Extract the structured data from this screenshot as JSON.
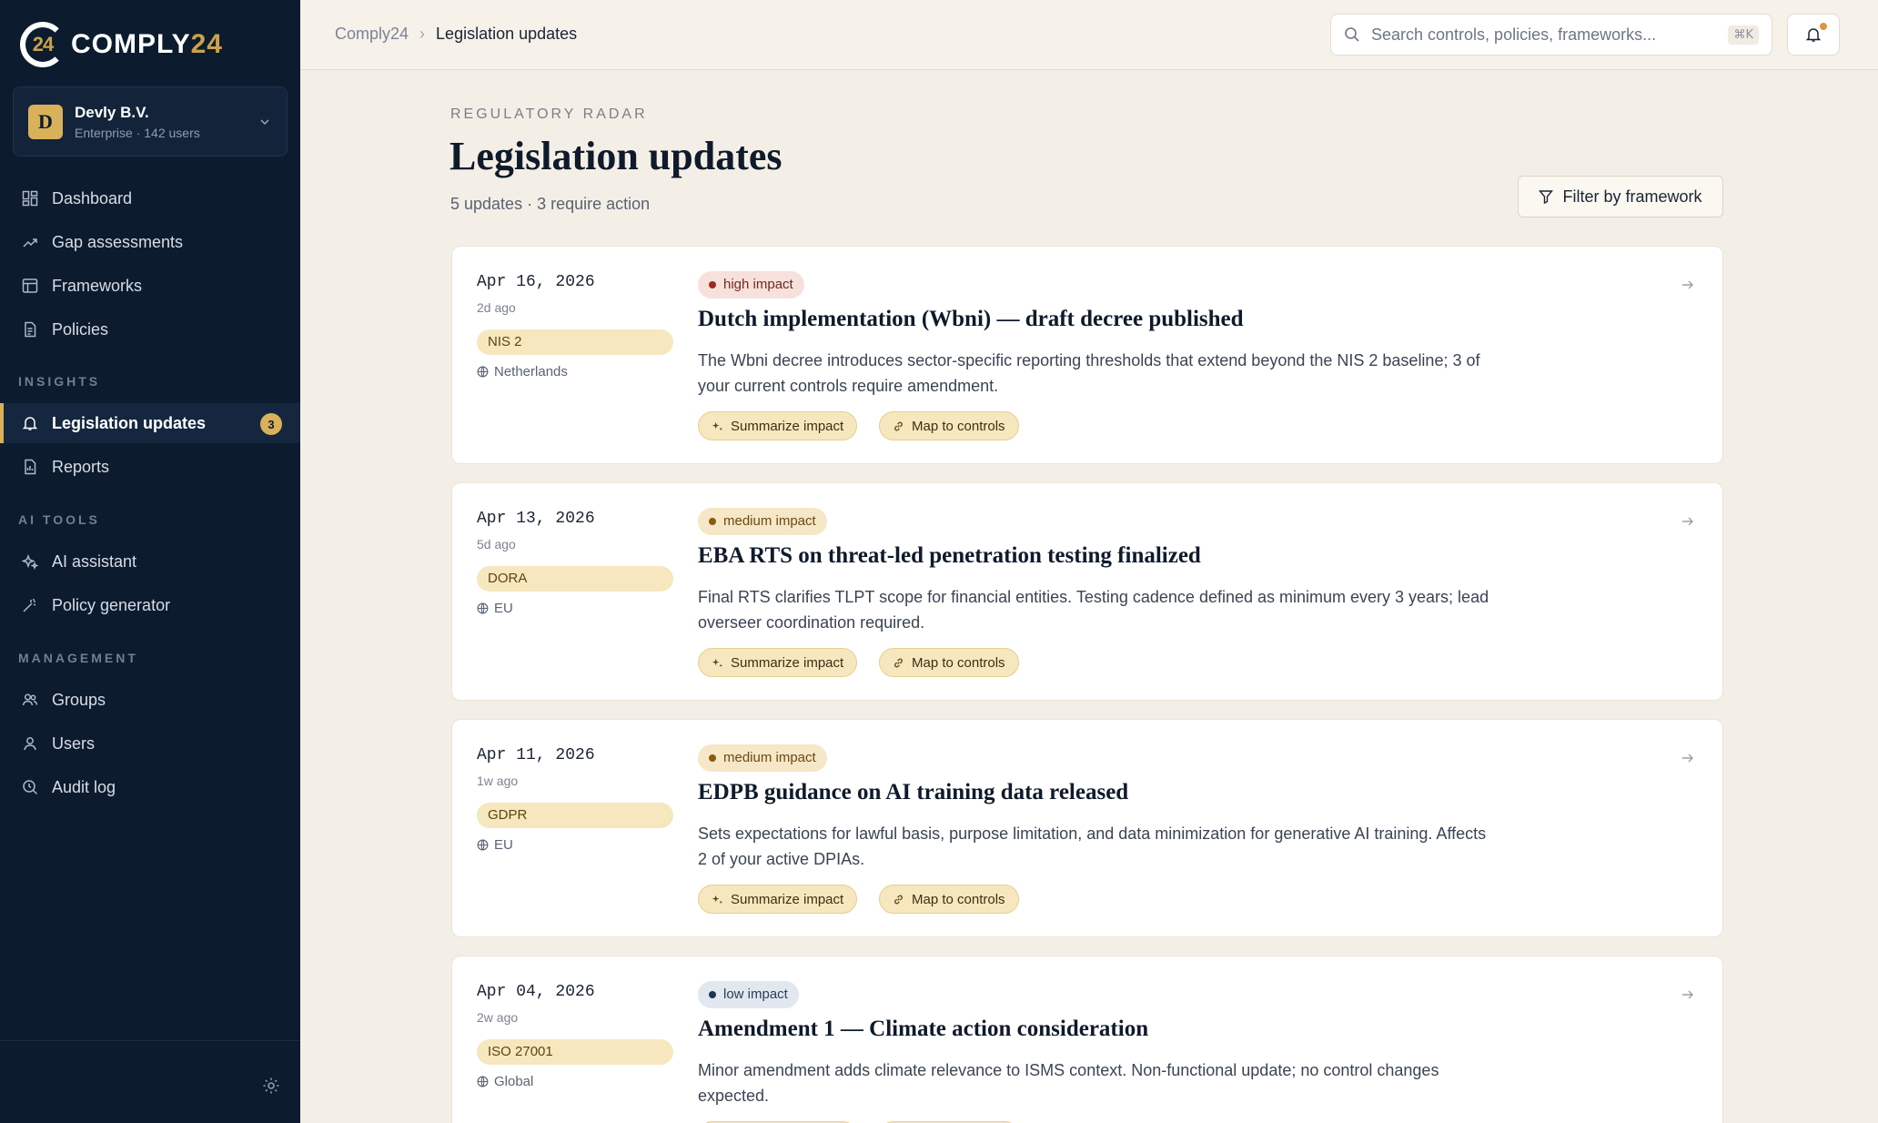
{
  "brand": {
    "mark": "24",
    "name_main": "COMPLY",
    "name_num": "24"
  },
  "org": {
    "initial": "D",
    "name": "Devly B.V.",
    "meta": "Enterprise · 142 users"
  },
  "nav": {
    "main": [
      {
        "label": "Dashboard",
        "icon": "dashboard-icon"
      },
      {
        "label": "Gap assessments",
        "icon": "trend-icon"
      },
      {
        "label": "Frameworks",
        "icon": "table-icon"
      },
      {
        "label": "Policies",
        "icon": "document-icon"
      }
    ],
    "insights_heading": "INSIGHTS",
    "insights": [
      {
        "label": "Legislation updates",
        "icon": "bell-icon",
        "badge": "3",
        "active": true
      },
      {
        "label": "Reports",
        "icon": "report-icon"
      }
    ],
    "ai_heading": "AI TOOLS",
    "ai": [
      {
        "label": "AI assistant",
        "icon": "sparkle-icon"
      },
      {
        "label": "Policy generator",
        "icon": "wand-icon"
      }
    ],
    "management_heading": "MANAGEMENT",
    "management": [
      {
        "label": "Groups",
        "icon": "users-icon"
      },
      {
        "label": "Users",
        "icon": "user-icon"
      },
      {
        "label": "Audit log",
        "icon": "search-log-icon"
      }
    ]
  },
  "breadcrumb": {
    "root": "Comply24",
    "current": "Legislation updates"
  },
  "search": {
    "placeholder": "Search controls, policies, frameworks...",
    "shortcut": "⌘K"
  },
  "page": {
    "eyebrow": "REGULATORY RADAR",
    "title": "Legislation updates",
    "subtitle": "5 updates · 3 require action",
    "filter_label": "Filter by framework"
  },
  "actions": {
    "summarize": "Summarize impact",
    "map": "Map to controls"
  },
  "updates": [
    {
      "date": "Apr 16, 2026",
      "ago": "2d ago",
      "framework": "NIS 2",
      "region": "Netherlands",
      "impact": "high impact",
      "impact_level": "high",
      "title": "Dutch implementation (Wbni) — draft decree published",
      "description": "The Wbni decree introduces sector-specific reporting thresholds that extend beyond the NIS 2 baseline; 3 of your current controls require amendment."
    },
    {
      "date": "Apr 13, 2026",
      "ago": "5d ago",
      "framework": "DORA",
      "region": "EU",
      "impact": "medium impact",
      "impact_level": "medium",
      "title": "EBA RTS on threat-led penetration testing finalized",
      "description": "Final RTS clarifies TLPT scope for financial entities. Testing cadence defined as minimum every 3 years; lead overseer coordination required."
    },
    {
      "date": "Apr 11, 2026",
      "ago": "1w ago",
      "framework": "GDPR",
      "region": "EU",
      "impact": "medium impact",
      "impact_level": "medium",
      "title": "EDPB guidance on AI training data released",
      "description": "Sets expectations for lawful basis, purpose limitation, and data minimization for generative AI training. Affects 2 of your active DPIAs."
    },
    {
      "date": "Apr 04, 2026",
      "ago": "2w ago",
      "framework": "ISO 27001",
      "region": "Global",
      "impact": "low impact",
      "impact_level": "low",
      "title": "Amendment 1 — Climate action consideration",
      "description": "Minor amendment adds climate relevance to ISMS context. Non-functional update; no control changes expected."
    }
  ],
  "colors": {
    "sidebar": "#0c1b2e",
    "accent": "#d9b15a",
    "background": "#f4efe6"
  }
}
